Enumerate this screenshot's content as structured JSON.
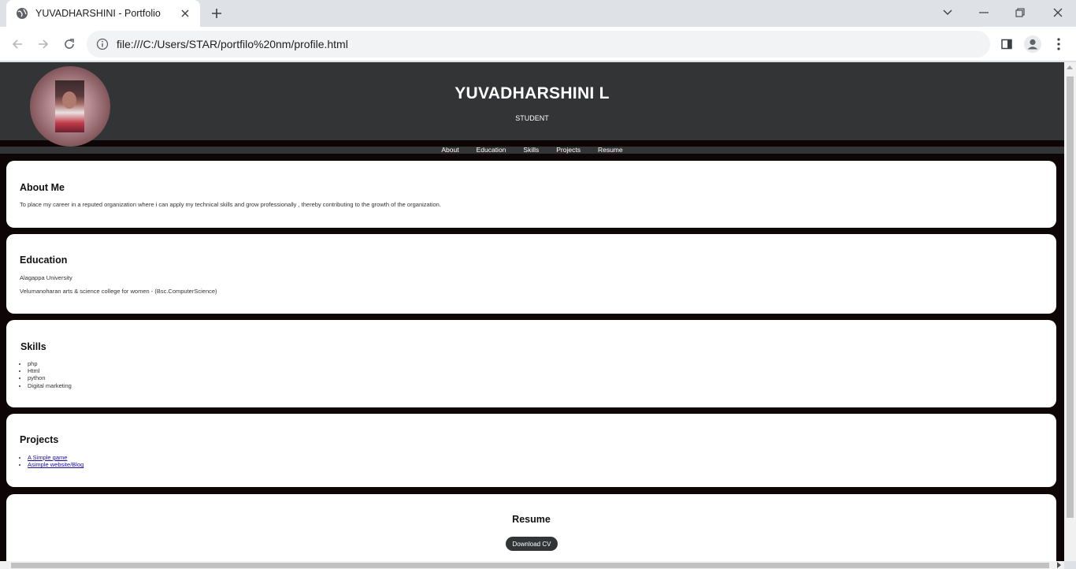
{
  "browser": {
    "tab_title": "YUVADHARSHINI - Portfolio",
    "url": "file:///C:/Users/STAR/portfilo%20nm/profile.html"
  },
  "site": {
    "name": "YUVADHARSHINI L",
    "role": "STUDENT",
    "nav": [
      "About",
      "Education",
      "Skills",
      "Projects",
      "Resume"
    ]
  },
  "about": {
    "heading": "About Me",
    "text": "To place my career in a reputed organization where i can apply my technical skills and grow professionally , thereby contributing to the growth of the organization."
  },
  "education": {
    "heading": "Education",
    "items": [
      "Alagappa University",
      "Velumanoharan arts & science college for women - (Bsc.ComputerScience)"
    ]
  },
  "skills": {
    "heading": "Skills",
    "items": [
      "php",
      "Html",
      "python",
      "Digital marketing"
    ]
  },
  "projects": {
    "heading": "Projects",
    "items": [
      "A Simple game",
      "Asimple website/Blog"
    ]
  },
  "resume": {
    "heading": "Resume",
    "button_label": "Download CV"
  },
  "colors": {
    "header_bg": "#333436",
    "page_bg": "#0e0506",
    "card_bg": "#ffffff",
    "link": "#1a0dab"
  }
}
